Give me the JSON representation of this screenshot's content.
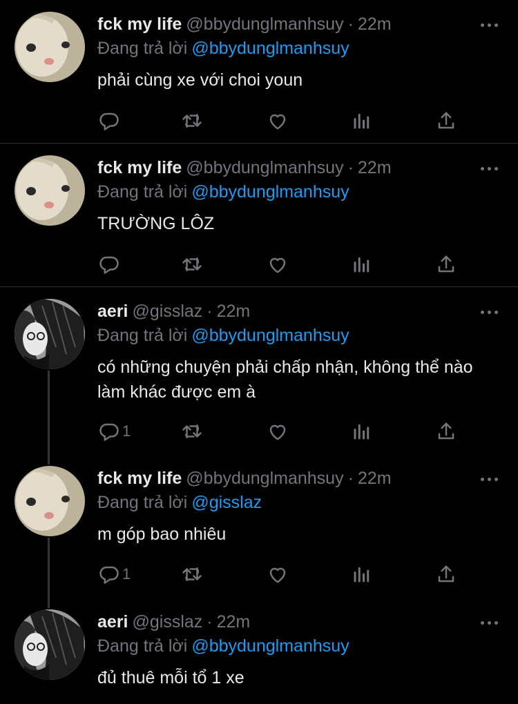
{
  "tweets": [
    {
      "name": "fck my life",
      "handle": "@bbydunglmanhsuy",
      "time": "22m",
      "reply_prefix": "Đang trả lời",
      "reply_to": "@bbydunglmanhsuy",
      "text": "phải cùng xe với choi youn",
      "reply_count": "",
      "avatar": "cat-avatar"
    },
    {
      "name": "fck my life",
      "handle": "@bbydunglmanhsuy",
      "time": "22m",
      "reply_prefix": "Đang trả lời",
      "reply_to": "@bbydunglmanhsuy",
      "text": "TRƯỜNG LÔZ",
      "reply_count": "",
      "avatar": "cat-avatar"
    },
    {
      "name": "aeri",
      "handle": "@gisslaz",
      "time": "22m",
      "reply_prefix": "Đang trả lời",
      "reply_to": "@bbydunglmanhsuy",
      "text": "có những chuyện phải chấp nhận, không thể nào làm khác được em à",
      "reply_count": "1",
      "avatar": "girl-avatar"
    },
    {
      "name": "fck my life",
      "handle": "@bbydunglmanhsuy",
      "time": "22m",
      "reply_prefix": "Đang trả lời",
      "reply_to": "@gisslaz",
      "text": "m góp bao nhiêu",
      "reply_count": "1",
      "avatar": "cat-avatar"
    },
    {
      "name": "aeri",
      "handle": "@gisslaz",
      "time": "22m",
      "reply_prefix": "Đang trả lời",
      "reply_to": "@bbydunglmanhsuy",
      "text": "đủ thuê mỗi tổ 1 xe",
      "reply_count": "",
      "avatar": "girl-avatar"
    }
  ],
  "colors": {
    "background": "#000000",
    "text": "#e7e9ea",
    "muted": "#71767b",
    "link": "#1d9bf0",
    "divider": "#2f3336"
  }
}
